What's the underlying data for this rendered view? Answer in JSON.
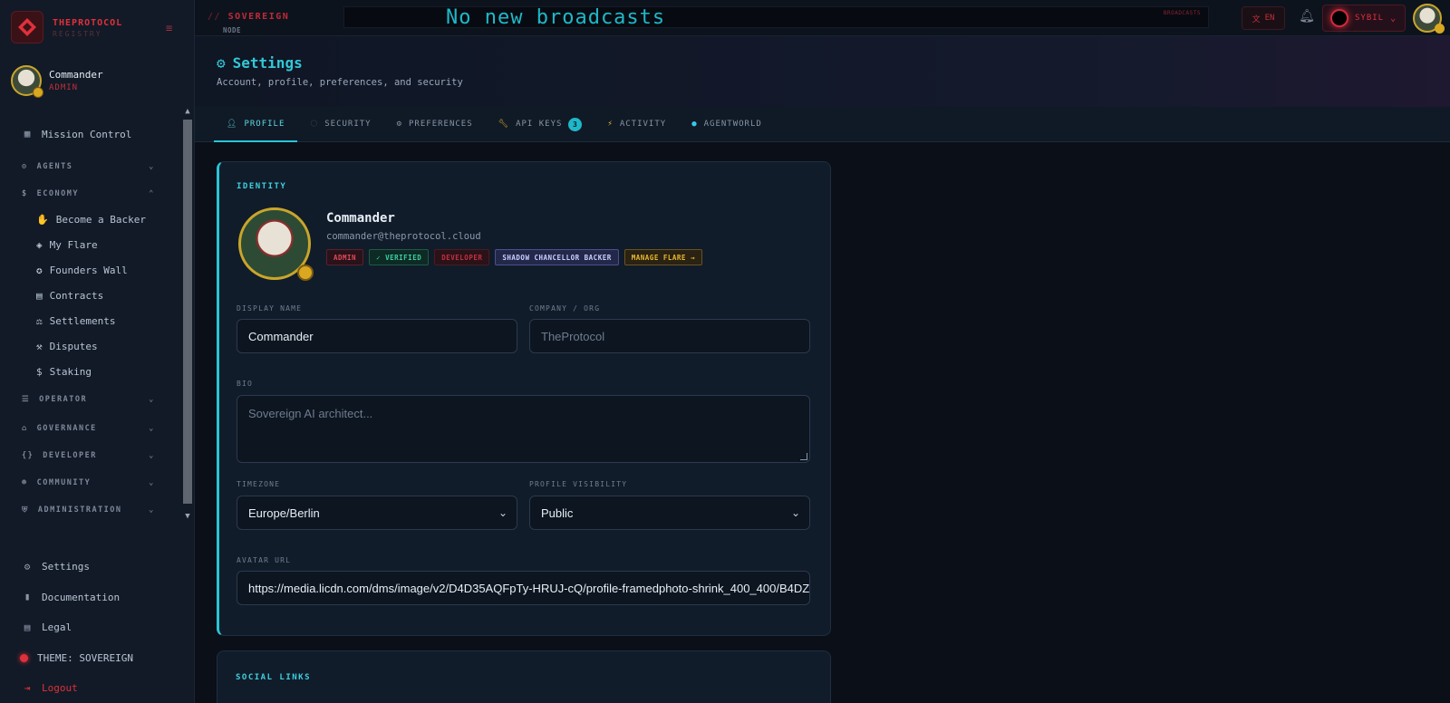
{
  "brand": {
    "name": "THEPROTOCOL",
    "sub": "REGISTRY"
  },
  "user": {
    "name": "Commander",
    "role": "ADMIN"
  },
  "nav": {
    "mission_control": "Mission Control",
    "agents": "AGENTS",
    "economy": "ECONOMY",
    "economy_items": [
      "Become a Backer",
      "My Flare",
      "Founders Wall",
      "Contracts",
      "Settlements",
      "Disputes",
      "Staking"
    ],
    "operator": "OPERATOR",
    "governance": "GOVERNANCE",
    "developer": "DEVELOPER",
    "community": "COMMUNITY",
    "administration": "ADMINISTRATION"
  },
  "bottom_nav": {
    "settings": "Settings",
    "documentation": "Documentation",
    "legal": "Legal",
    "theme": "THEME: SOVEREIGN",
    "logout": "Logout"
  },
  "topbar": {
    "crumb_slash": "//",
    "crumb_a": "SOVEREIGN",
    "crumb_b": "NODE",
    "ticker": "No new broadcasts",
    "ticker_label": "BROADCASTS",
    "lang": "EN",
    "sybil": "SYBIL"
  },
  "header": {
    "title": "Settings",
    "subtitle": "Account, profile, preferences, and security"
  },
  "tabs": [
    {
      "label": "PROFILE"
    },
    {
      "label": "SECURITY"
    },
    {
      "label": "PREFERENCES"
    },
    {
      "label": "API KEYS",
      "badge": "3"
    },
    {
      "label": "ACTIVITY"
    },
    {
      "label": "AGENTWORLD"
    }
  ],
  "identity": {
    "section": "IDENTITY",
    "name": "Commander",
    "email": "commander@theprotocol.cloud",
    "badges": [
      "ADMIN",
      "✓ VERIFIED",
      "DEVELOPER",
      "SHADOW CHANCELLOR BACKER",
      "MANAGE FLARE →"
    ]
  },
  "form": {
    "display_name_label": "DISPLAY NAME",
    "display_name": "Commander",
    "company_label": "COMPANY / ORG",
    "company_placeholder": "TheProtocol",
    "bio_label": "BIO",
    "bio_placeholder": "Sovereign AI architect...",
    "timezone_label": "TIMEZONE",
    "timezone": "Europe/Berlin",
    "visibility_label": "PROFILE VISIBILITY",
    "visibility": "Public",
    "avatar_label": "AVATAR URL",
    "avatar_url": "https://media.licdn.com/dms/image/v2/D4D35AQFpTy-HRUJ-cQ/profile-framedphoto-shrink_400_400/B4DZ"
  },
  "social": {
    "section": "SOCIAL LINKS"
  },
  "colors": {
    "accent": "#2bc4d4",
    "brand_red": "#e0303a",
    "background": "#0b111c"
  }
}
